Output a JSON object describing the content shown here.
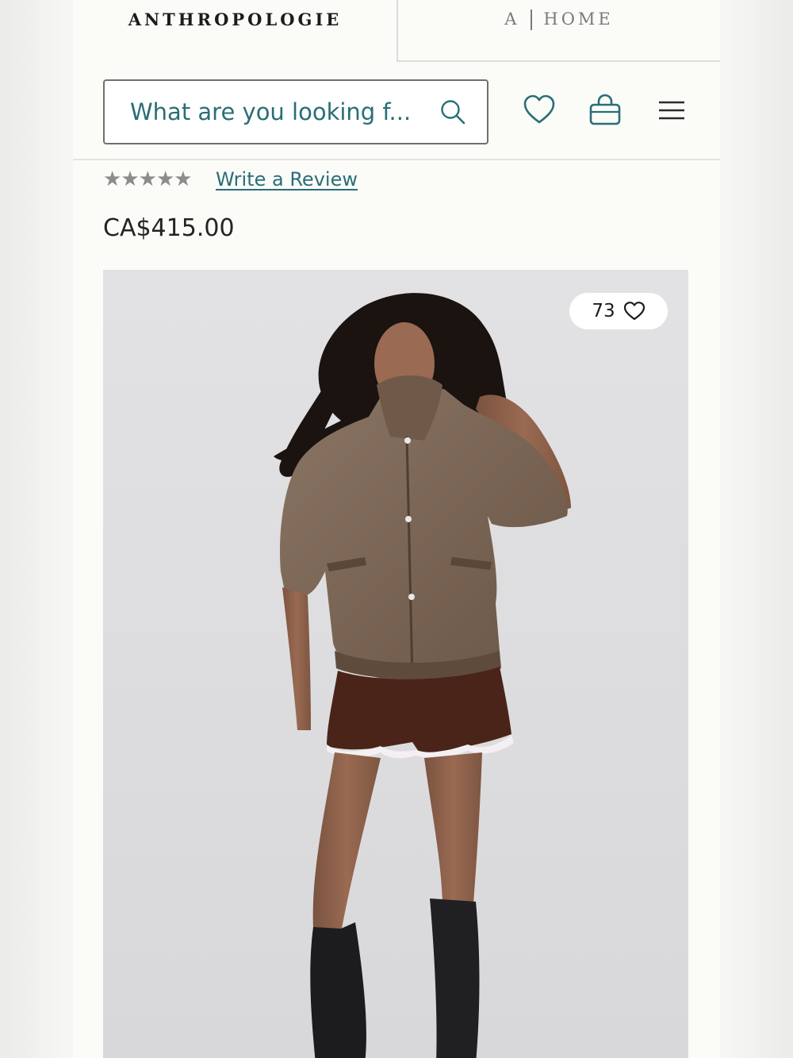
{
  "header": {
    "brand_active": "ANTHROPOLOGIE",
    "brand_inactive_prefix": "A",
    "brand_inactive_label": "HOME"
  },
  "search": {
    "placeholder": "What are you looking f..."
  },
  "icons": {
    "search": "search-icon",
    "wishlist": "heart-icon",
    "bag": "shopping-bag-icon",
    "menu": "hamburger-menu-icon"
  },
  "product": {
    "rating_stars": 5,
    "rating_filled": 0,
    "write_review_label": "Write a Review",
    "price": "CA$415.00",
    "favorites_count": "73"
  },
  "colors": {
    "accent": "#2a6e76",
    "star": "#8c8c8c",
    "text": "#242424"
  }
}
